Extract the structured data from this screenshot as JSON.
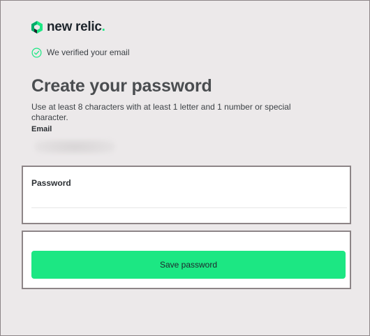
{
  "brand": {
    "name": "new relic",
    "accent_color": "#1ce783",
    "logo_icon": "new-relic-logo-icon"
  },
  "verification": {
    "icon": "check-circle-icon",
    "text": "We verified your email"
  },
  "page": {
    "title": "Create your password",
    "hint": "Use at least 8 characters with at least 1 letter and 1 number or special character."
  },
  "email": {
    "label": "Email"
  },
  "password": {
    "label": "Password",
    "value": ""
  },
  "actions": {
    "save_label": "Save password"
  }
}
